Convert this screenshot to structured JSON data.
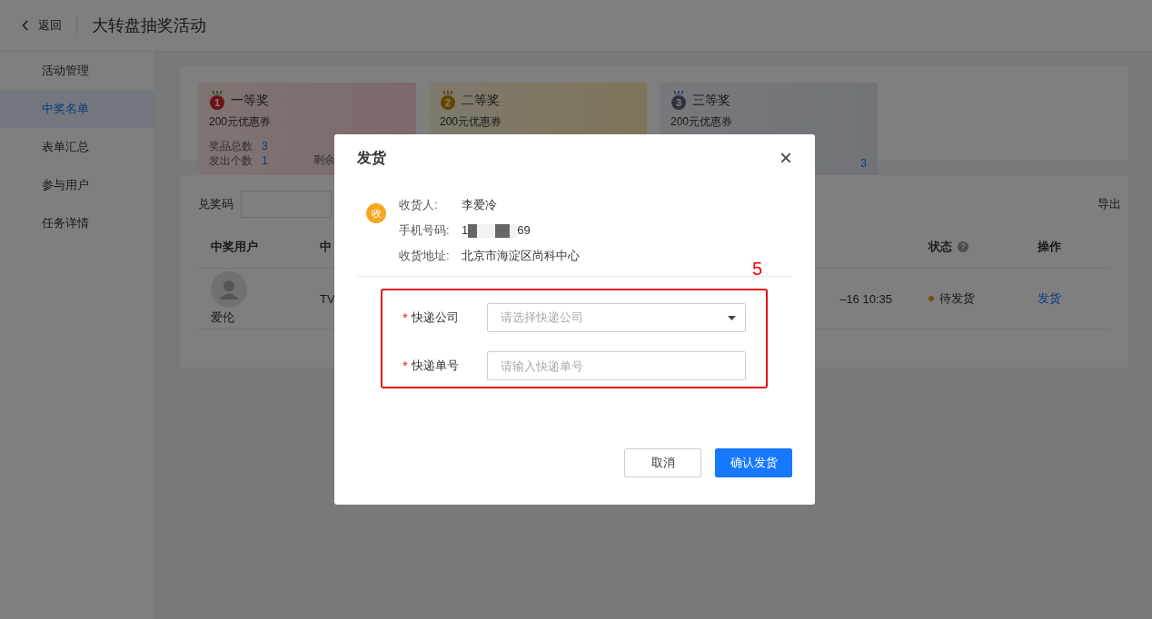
{
  "header": {
    "back_label": "返回",
    "title": "大转盘抽奖活动"
  },
  "sidebar": {
    "items": [
      {
        "label": "活动管理",
        "selected": false
      },
      {
        "label": "中奖名单",
        "selected": true
      },
      {
        "label": "表单汇总",
        "selected": false
      },
      {
        "label": "参与用户",
        "selected": false
      },
      {
        "label": "任务详情",
        "selected": false
      }
    ]
  },
  "prize_cards": [
    {
      "rank": "1",
      "name": "一等奖",
      "description": "200元优惠券",
      "stats": [
        {
          "label": "奖品总数",
          "value": "3"
        },
        {
          "label": "发出个数",
          "value": "1"
        }
      ],
      "remaining_label": "剩余"
    },
    {
      "rank": "2",
      "name": "二等奖",
      "description": "200元优惠券"
    },
    {
      "rank": "3",
      "name": "三等奖",
      "description": "200元优惠券",
      "remaining_value": "3"
    }
  ],
  "filter": {
    "label": "兑奖码",
    "export_label": "导出"
  },
  "table": {
    "columns": [
      "中奖用户",
      "中",
      "状态",
      "操作"
    ],
    "rows": [
      {
        "user": "爱伦",
        "column_2": "TV",
        "time": "–16 10:35",
        "status": "待发货",
        "action": "发货"
      }
    ]
  },
  "dialog": {
    "title": "发货",
    "close": "×",
    "badge": "收",
    "info": [
      {
        "label": "收货人:",
        "value": "李爱冷",
        "kind": "text"
      },
      {
        "label": "手机号码:",
        "value_start": "1",
        "value_end": "69",
        "kind": "masked"
      },
      {
        "label": "收货地址:",
        "value": "北京市海淀区尚科中心",
        "kind": "text"
      }
    ],
    "annotation": "5",
    "fields": [
      {
        "label": "快递公司",
        "required_mark": "*",
        "placeholder": "请选择快递公司",
        "kind": "select"
      },
      {
        "label": "快递单号",
        "required_mark": "*",
        "placeholder": "请输入快递单号",
        "kind": "input"
      }
    ],
    "buttons": [
      {
        "label": "取消",
        "primary": false
      },
      {
        "label": "确认发货",
        "primary": true
      }
    ]
  }
}
